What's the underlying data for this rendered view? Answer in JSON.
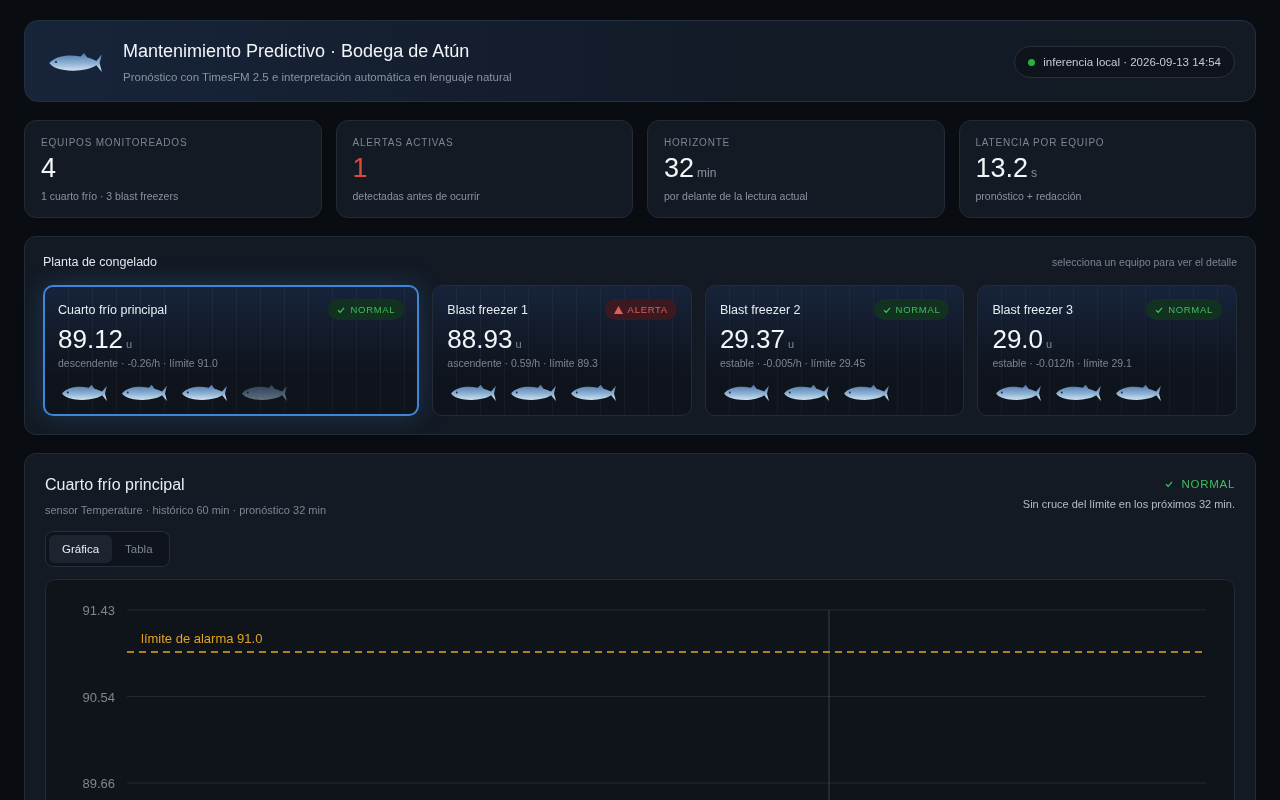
{
  "header": {
    "title": "Mantenimiento Predictivo · Bodega de Atún",
    "subtitle": "Pronóstico con TimesFM 2.5 e interpretación automática en lenguaje natural",
    "status": {
      "online": true,
      "text": "inferencia local · 2026-09-13 14:54"
    }
  },
  "kpis": [
    {
      "label": "EQUIPOS MONITOREADOS",
      "value": "4",
      "note": "1 cuarto frío · 3 blast freezers",
      "alert": false
    },
    {
      "label": "ALERTAS ACTIVAS",
      "value": "1",
      "note": "detectadas antes de ocurrir",
      "alert": true
    },
    {
      "label": "HORIZONTE",
      "value": "32",
      "unit": "min",
      "note": "por delante de la lectura actual",
      "alert": false
    },
    {
      "label": "LATENCIA POR EQUIPO",
      "value": "13.2",
      "unit": "s",
      "note": "pronóstico + redacción",
      "alert": false
    }
  ],
  "plant": {
    "title": "Planta de congelado",
    "hint": "selecciona un equipo para ver el detalle",
    "equipment": [
      {
        "name": "Cuarto frío principal",
        "selected": true,
        "alert": false,
        "status_label": "NORMAL",
        "value": "89.12",
        "unit": "u",
        "detail": "descendente · -0.26/h · límite 91.0",
        "fish": [
          {
            "loaded": true
          },
          {
            "loaded": true
          },
          {
            "loaded": true
          },
          {
            "loaded": false
          }
        ]
      },
      {
        "name": "Blast freezer 1",
        "selected": false,
        "alert": true,
        "status_label": "ALERTA",
        "value": "88.93",
        "unit": "u",
        "detail": "ascendente · 0.59/h · límite 89.3",
        "fish": [
          {
            "loaded": true
          },
          {
            "loaded": true
          },
          {
            "loaded": true
          }
        ]
      },
      {
        "name": "Blast freezer 2",
        "selected": false,
        "alert": false,
        "status_label": "NORMAL",
        "value": "29.37",
        "unit": "u",
        "detail": "estable · -0.005/h · límite 29.45",
        "fish": [
          {
            "loaded": true
          },
          {
            "loaded": true
          },
          {
            "loaded": true
          }
        ]
      },
      {
        "name": "Blast freezer 3",
        "selected": false,
        "alert": false,
        "status_label": "NORMAL",
        "value": "29.0",
        "unit": "u",
        "detail": "estable · -0.012/h · límite 29.1",
        "fish": [
          {
            "loaded": true
          },
          {
            "loaded": true
          },
          {
            "loaded": true
          }
        ]
      }
    ]
  },
  "detail": {
    "title": "Cuarto frío principal",
    "subtitle": "sensor Temperature · histórico 60 min · pronóstico 32 min",
    "alert": false,
    "status_label": "NORMAL",
    "message": "Sin cruce del límite en los próximos 32 min.",
    "tabs": [
      {
        "label": "Gráfica",
        "selected": true
      },
      {
        "label": "Tabla",
        "selected": false
      }
    ],
    "chart": {
      "axis_labels": [
        "91.43",
        "90.54",
        "89.66"
      ],
      "threshold_label": "límite de alarma 91.0"
    }
  }
}
